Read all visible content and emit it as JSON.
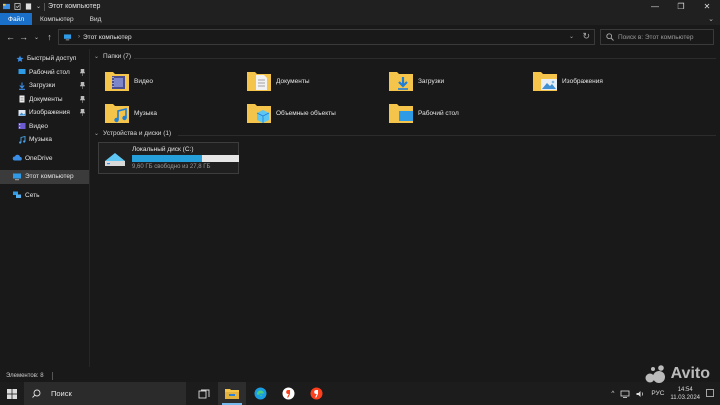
{
  "window": {
    "title": "Этот компьютер",
    "controls": {
      "minimize": "—",
      "maximize": "❐",
      "close": "✕"
    }
  },
  "ribbon": {
    "tabs": [
      {
        "label": "Файл",
        "active": true
      },
      {
        "label": "Компьютер",
        "active": false
      },
      {
        "label": "Вид",
        "active": false
      }
    ],
    "expand": "⌄"
  },
  "address": {
    "crumb": "Этот компьютер",
    "chevron": "›",
    "dropdown": "⌄",
    "refresh": "↻",
    "nav": {
      "back": "←",
      "forward": "→",
      "recent": "⌄",
      "up": "↑"
    }
  },
  "search": {
    "placeholder": "Поиск в: Этот компьютер"
  },
  "sidebar": {
    "items": [
      {
        "label": "Быстрый доступ",
        "icon": "star-icon",
        "pinned": false
      },
      {
        "label": "Рабочий стол",
        "icon": "desktop-icon",
        "pinned": true
      },
      {
        "label": "Загрузки",
        "icon": "download-icon",
        "pinned": true
      },
      {
        "label": "Документы",
        "icon": "documents-icon",
        "pinned": true
      },
      {
        "label": "Изображения",
        "icon": "pictures-icon",
        "pinned": true
      },
      {
        "label": "Видео",
        "icon": "video-icon",
        "pinned": false
      },
      {
        "label": "Музыка",
        "icon": "music-icon",
        "pinned": false
      },
      {
        "label": "OneDrive",
        "icon": "cloud-icon",
        "pinned": false
      },
      {
        "label": "Этот компьютер",
        "icon": "computer-icon",
        "pinned": false,
        "selected": true
      },
      {
        "label": "Сеть",
        "icon": "network-icon",
        "pinned": false
      }
    ]
  },
  "folders_group": {
    "title": "Папки (7)",
    "items": [
      {
        "label": "Видео",
        "icon": "video-folder-icon"
      },
      {
        "label": "Документы",
        "icon": "documents-folder-icon"
      },
      {
        "label": "Загрузки",
        "icon": "downloads-folder-icon"
      },
      {
        "label": "Изображения",
        "icon": "pictures-folder-icon"
      },
      {
        "label": "Музыка",
        "icon": "music-folder-icon"
      },
      {
        "label": "Объемные объекты",
        "icon": "3d-objects-folder-icon"
      },
      {
        "label": "Рабочий стол",
        "icon": "desktop-folder-icon"
      }
    ]
  },
  "drives_group": {
    "title": "Устройства и диски (1)",
    "items": [
      {
        "label": "Локальный диск (C:)",
        "free_text": "9,60 ГБ свободно из 27,8 ГБ",
        "used_fraction": 0.655,
        "icon": "drive-icon"
      }
    ]
  },
  "status": {
    "items_count": "Элементов: 8"
  },
  "taskbar": {
    "search_label": "Поиск",
    "apps": [
      "task-view-icon",
      "file-explorer-icon",
      "edge-icon",
      "yandex-browser-icon",
      "yandex-icon"
    ],
    "tray": {
      "chevron": "^",
      "language": "РУС",
      "time": "14:54",
      "date": "11.03.2024"
    }
  },
  "watermark": {
    "text": "Avito"
  },
  "colors": {
    "accent": "#1a6fc9",
    "drive_fill": "#26a0da",
    "folder": "#f4c54a"
  }
}
